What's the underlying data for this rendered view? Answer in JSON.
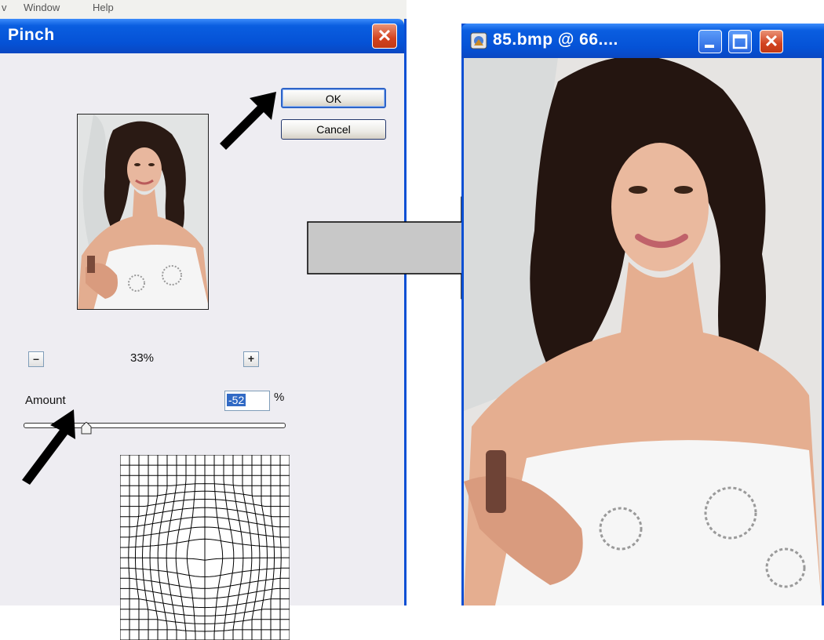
{
  "menu": {
    "window": "Window",
    "help": "Help",
    "cut_left": "v"
  },
  "dialog": {
    "title": "Pinch",
    "ok_label": "OK",
    "cancel_label": "Cancel",
    "zoom_minus": "–",
    "zoom_plus": "+",
    "zoom_value": "33%",
    "amount_label": "Amount",
    "amount_value": "-52",
    "amount_unit": "%",
    "amount_slider_fraction": 0.24
  },
  "image_window": {
    "title": "85.bmp @ 66...."
  },
  "colors": {
    "titlebar": "#0552d6",
    "close_red": "#d2421f",
    "dialog_bg": "#eeedf2",
    "arrow_fill": "#c8c8c8",
    "pointer": "#000000"
  },
  "icons": [
    "close-icon",
    "minimize-icon",
    "maximize-icon",
    "document-icon",
    "arrow-right-icon",
    "pointer-arrow-icon"
  ]
}
